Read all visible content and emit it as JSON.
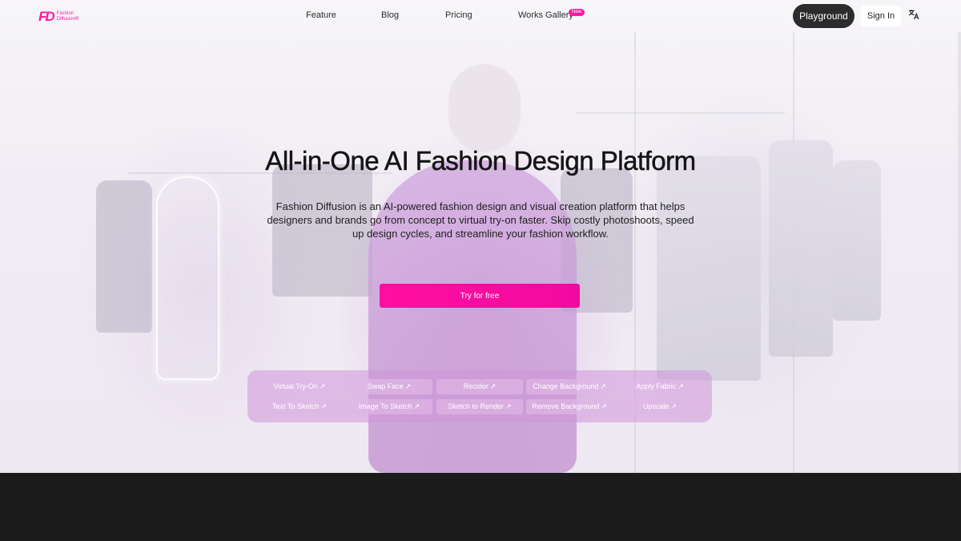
{
  "brand": {
    "mark": "FD",
    "name_line1": "Fashion",
    "name_line2": "Diffusion®"
  },
  "nav": {
    "links": [
      "Feature",
      "Blog",
      "Pricing",
      "Works Gallery"
    ],
    "new_badge": "New",
    "playground": "Playground",
    "sign_in": "Sign In",
    "translate_icon": "translate-icon"
  },
  "hero": {
    "title": "All-in-One AI Fashion Design Platform",
    "subtitle": "Fashion Diffusion is an AI-powered fashion design and visual creation platform that helps designers and brands go from concept to virtual try-on faster. Skip costly photoshoots, speed up design cycles, and streamline your fashion workflow.",
    "cta": "Try for free"
  },
  "tools": [
    "Virtual Try-On",
    "Swap Face",
    "Recolor",
    "Change Background",
    "Apply Fabric",
    "Text To Sketch",
    "Image To Sketch",
    "Sketch to Render",
    "Remove Background",
    "Upscale"
  ],
  "tool_arrow": "↗",
  "colors": {
    "accent": "#ff1aa1",
    "dark": "#2c2c2c",
    "footer": "#1c1c1c"
  }
}
